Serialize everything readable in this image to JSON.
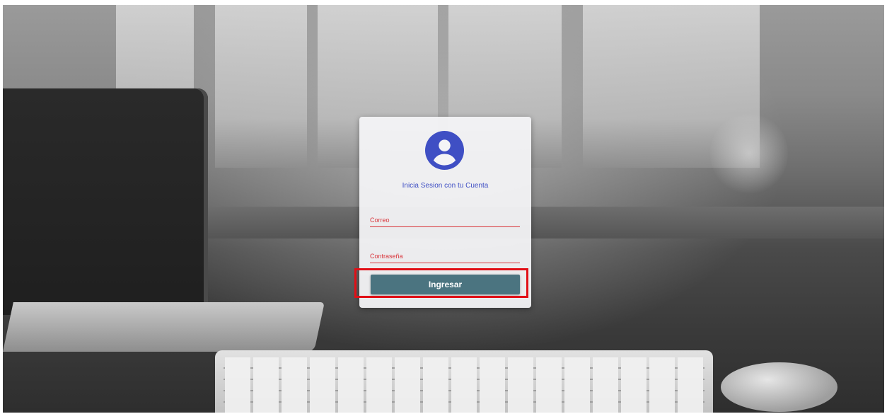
{
  "login": {
    "icon": "account-circle-icon",
    "subtitle": "Inicia Sesion con tu Cuenta",
    "email_label": "Correo",
    "password_label": "Contraseña",
    "submit_label": "Ingresar"
  },
  "colors": {
    "accent_blue": "#3f4fc4",
    "field_red": "#d9363c",
    "button_teal": "#4b7480",
    "highlight_red": "#e10f16"
  }
}
